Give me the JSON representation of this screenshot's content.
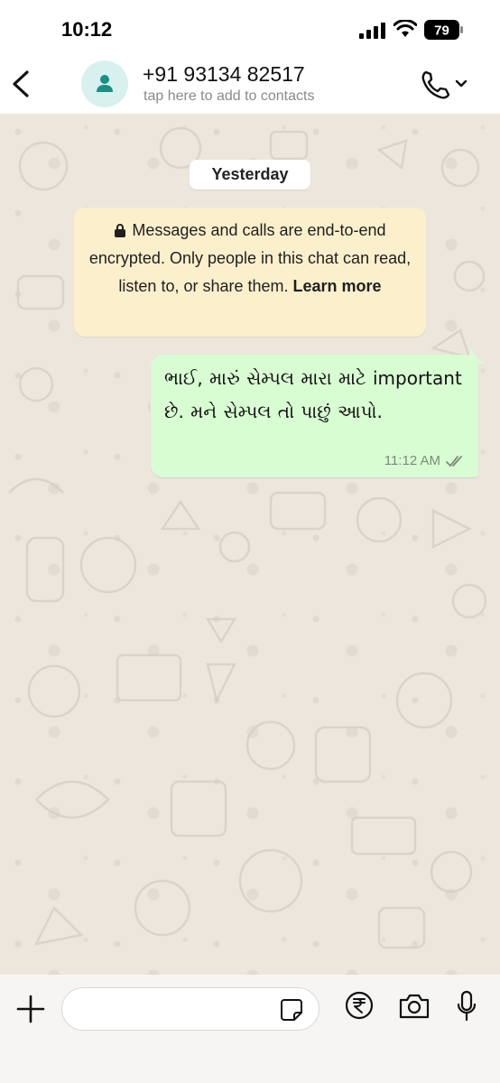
{
  "status_bar": {
    "time": "10:12",
    "battery": "79"
  },
  "header": {
    "contact_name": "+91 93134 82517",
    "contact_subtitle": "tap here to add to contacts",
    "icons": [
      "back-icon",
      "person-icon",
      "phone-icon",
      "chevron-down-icon"
    ]
  },
  "chat": {
    "date_label": "Yesterday",
    "encryption_notice": {
      "text": "Messages and calls are end-to-end encrypted. Only people in this chat can read, listen to, or share them.",
      "link": "Learn more"
    },
    "messages": [
      {
        "direction": "outgoing",
        "text": "ભાઈ, મારું સેમ્પલ મારા માટે important છે. મને સેમ્પલ તો પાછું આપો.",
        "time": "11:12 AM",
        "status": "delivered-double-tick"
      }
    ]
  },
  "input_bar": {
    "icons": [
      "plus-icon",
      "sticker-icon",
      "rupee-icon",
      "camera-icon",
      "mic-icon"
    ]
  },
  "colors": {
    "outgoing_bubble": "#d9fdd3",
    "encryption_bubble": "#fcefcc",
    "chat_background": "#ece6dd"
  }
}
